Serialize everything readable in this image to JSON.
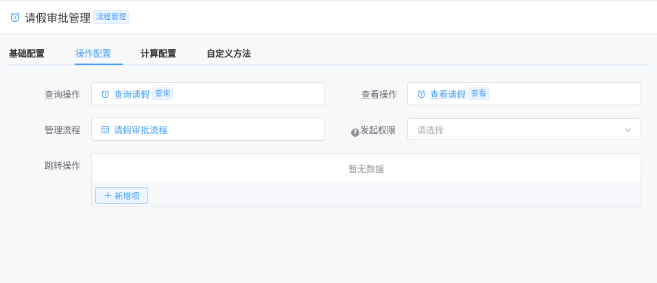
{
  "header": {
    "title": "请假审批管理",
    "badge": "流程管理"
  },
  "tabs": [
    {
      "label": "基础配置",
      "active": false
    },
    {
      "label": "操作配置",
      "active": true
    },
    {
      "label": "计算配置",
      "active": false
    },
    {
      "label": "自定义方法",
      "active": false
    }
  ],
  "form": {
    "query_op": {
      "label": "查询操作",
      "value": "查询请假",
      "tag": "查询"
    },
    "view_op": {
      "label": "查看操作",
      "value": "查看请假",
      "tag": "查看"
    },
    "manage_flow": {
      "label": "管理流程",
      "value": "请假审批流程"
    },
    "initiate_permission": {
      "label": "发起权限",
      "placeholder": "请选择",
      "help_icon": "?"
    },
    "jump_op": {
      "label": "跳转操作",
      "empty_text": "暂无数据",
      "add_button": "新增项"
    }
  },
  "icons": {
    "clock": "alarm-clock-icon",
    "flow": "calendar-flow-icon",
    "help": "question-circle-icon",
    "chevron": "chevron-down-icon",
    "plus": "plus-icon"
  },
  "colors": {
    "accent": "#409eff",
    "text": "#303133",
    "muted": "#606266"
  }
}
